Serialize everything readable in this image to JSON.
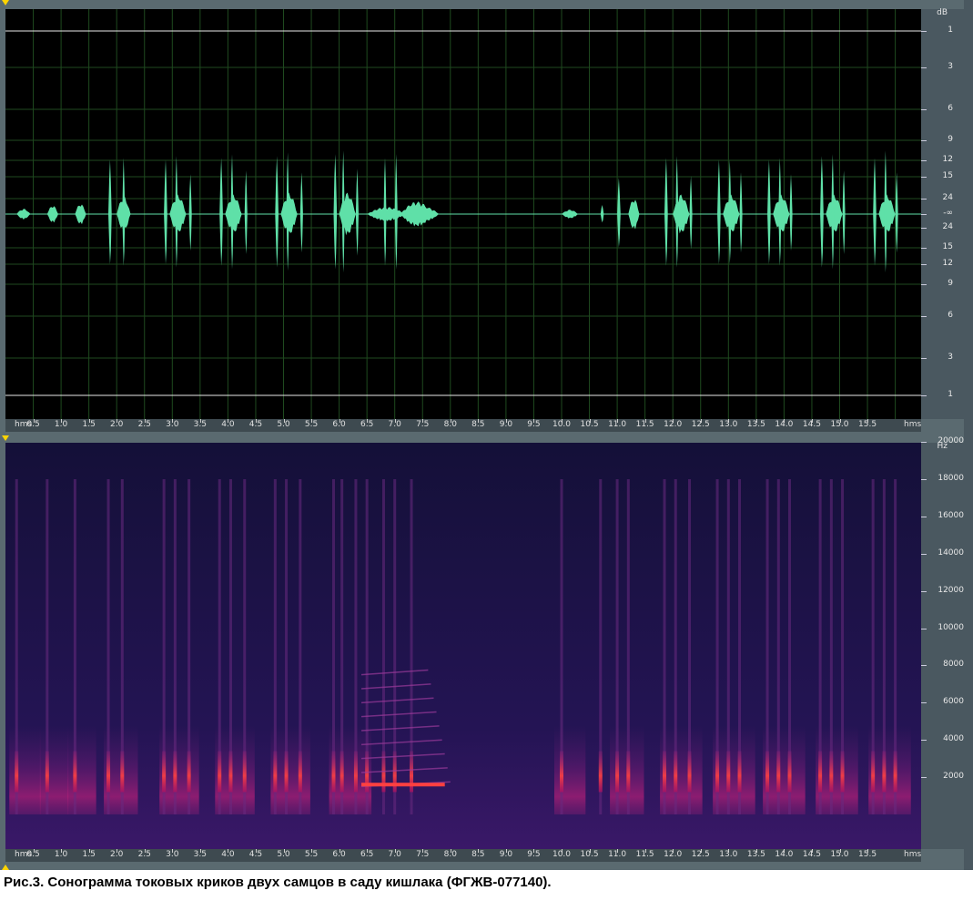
{
  "waveform": {
    "db_unit": "dB",
    "db_labels": [
      "1",
      "3",
      "6",
      "9",
      "12",
      "15",
      "24",
      "-∞",
      "24",
      "15",
      "12",
      "9",
      "6",
      "3",
      "1"
    ],
    "colors": {
      "background": "#000000",
      "wave": "#5fe0a8",
      "grid": "#1f4a1f",
      "limit": "#e8e8e8"
    }
  },
  "spectrogram": {
    "hz_unit": "Hz",
    "hz_labels": [
      "20000",
      "18000",
      "16000",
      "14000",
      "12000",
      "10000",
      "8000",
      "6000",
      "4000",
      "2000"
    ],
    "colors": {
      "background": "#1a1040",
      "hot": "#ff4040",
      "mid": "#c0207a"
    }
  },
  "time_ruler": {
    "start_label": "hms",
    "end_label": "hms",
    "ticks": [
      "0.5",
      "1.0",
      "1.5",
      "2.0",
      "2.5",
      "3.0",
      "3.5",
      "4.0",
      "4.5",
      "5.0",
      "5.5",
      "6.0",
      "6.5",
      "7.0",
      "7.5",
      "8.0",
      "8.5",
      "9.0",
      "9.5",
      "10.0",
      "10.5",
      "11.0",
      "11.5",
      "12.0",
      "12.5",
      "13.0",
      "13.5",
      "14.0",
      "14.5",
      "15.0",
      "15.5"
    ]
  },
  "caption": "Рис.3. Сонограмма токовых криков двух самцов в саду кишлака (ФГЖВ-077140).",
  "calls_seconds": [
    0.2,
    0.75,
    1.25,
    1.85,
    2.1,
    2.85,
    3.05,
    3.3,
    3.85,
    4.05,
    4.3,
    4.85,
    5.05,
    5.3,
    5.9,
    6.05,
    6.3,
    6.5,
    6.8,
    7.0,
    7.3,
    10.0,
    10.7,
    11.0,
    11.2,
    11.85,
    12.05,
    12.3,
    12.8,
    13.0,
    13.2,
    13.7,
    13.9,
    14.1,
    14.65,
    14.85,
    15.05,
    15.6,
    15.8,
    16.0
  ]
}
